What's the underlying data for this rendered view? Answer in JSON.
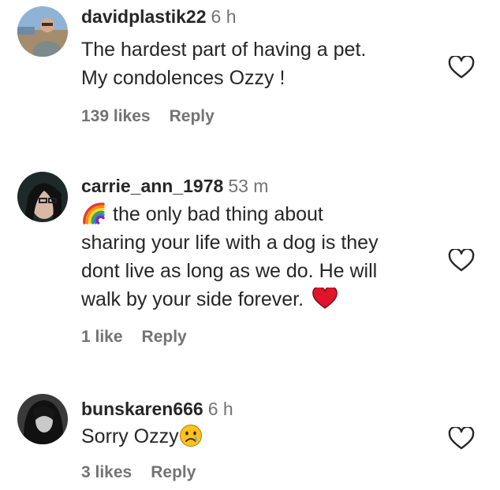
{
  "comments": [
    {
      "username": "davidplastik22",
      "time": "6 h",
      "lines": [
        "The hardest part of having a pet.",
        "My condolences Ozzy !"
      ],
      "likes": "139 likes",
      "reply": "Reply",
      "like_icon": "heart-outline-icon"
    },
    {
      "username": "carrie_ann_1978",
      "time": "53 m",
      "lines": [
        "the only bad thing about",
        "sharing your life with a dog is they",
        "dont live as long as we do. He will",
        "walk by your side forever."
      ],
      "leading_emoji": "rainbow-emoji",
      "trailing_emoji": "red-heart-emoji",
      "likes": "1 like",
      "reply": "Reply",
      "like_icon": "heart-outline-icon"
    },
    {
      "username": "bunskaren666",
      "time": "6 h",
      "lines": [
        "Sorry Ozzy"
      ],
      "trailing_emoji": "crying-face-emoji",
      "likes": "3 likes",
      "reply": "Reply",
      "like_icon": "heart-outline-icon"
    }
  ],
  "colors": {
    "text": "#262626",
    "secondary": "#737373",
    "heart_red": "#e0142b"
  }
}
